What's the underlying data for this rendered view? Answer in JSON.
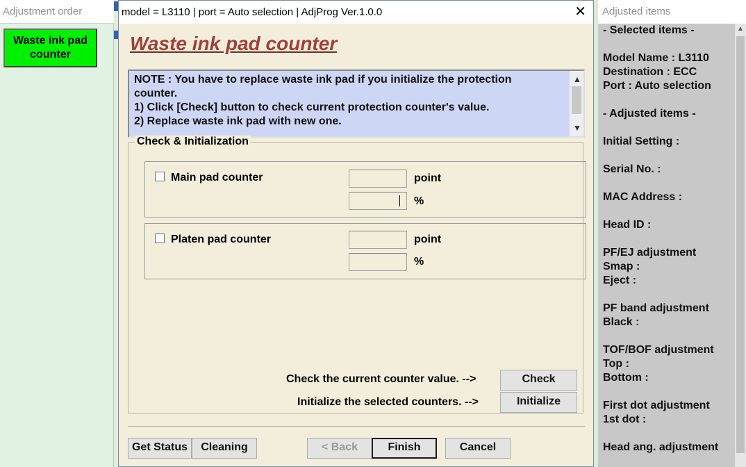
{
  "left_panel": {
    "title": "Adjustment order",
    "active_item": "Waste ink pad counter"
  },
  "dialog": {
    "window_title": "model = L3110 | port = Auto selection | AdjProg Ver.1.0.0",
    "close_glyph": "✕",
    "page_title": "Waste ink pad counter",
    "note_lines": [
      "NOTE : You have to replace waste ink pad if you initialize the protection",
      "counter.",
      "1) Click [Check] button to check current protection counter's value.",
      "2) Replace waste ink pad with new one."
    ],
    "group_label": "Check & Initialization",
    "counters": [
      {
        "label": "Main pad counter",
        "checked": false,
        "point_value": "",
        "percent_value": ""
      },
      {
        "label": "Platen pad counter",
        "checked": false,
        "point_value": "",
        "percent_value": ""
      }
    ],
    "unit_point": "point",
    "unit_percent": "%",
    "check_hint": "Check the current counter value. -->",
    "check_button": "Check",
    "init_hint": "Initialize the selected counters. -->",
    "init_button": "Initialize",
    "footer": {
      "get_status": "Get Status",
      "cleaning": "Cleaning",
      "back": "< Back",
      "finish": "Finish",
      "cancel": "Cancel"
    }
  },
  "right_panel": {
    "title": "Adjusted items",
    "lines": [
      "- Selected items -",
      "",
      "Model Name : L3110",
      "Destination : ECC",
      "Port : Auto selection",
      "",
      "- Adjusted items -",
      "",
      "Initial Setting :",
      "",
      "Serial No. :",
      "",
      "MAC Address :",
      "",
      "Head ID :",
      "",
      "PF/EJ adjustment",
      " Smap :",
      " Eject :",
      "",
      "PF band adjustment",
      " Black :",
      "",
      "TOF/BOF adjustment",
      " Top :",
      " Bottom :",
      "",
      "First dot adjustment",
      " 1st dot :",
      "",
      "Head ang. adjustment"
    ]
  },
  "colors": {
    "active_item_bg": "#00f000",
    "title_color": "#a0403a",
    "note_bg": "#cdd6f5",
    "dialog_bg": "#f2eedb"
  }
}
